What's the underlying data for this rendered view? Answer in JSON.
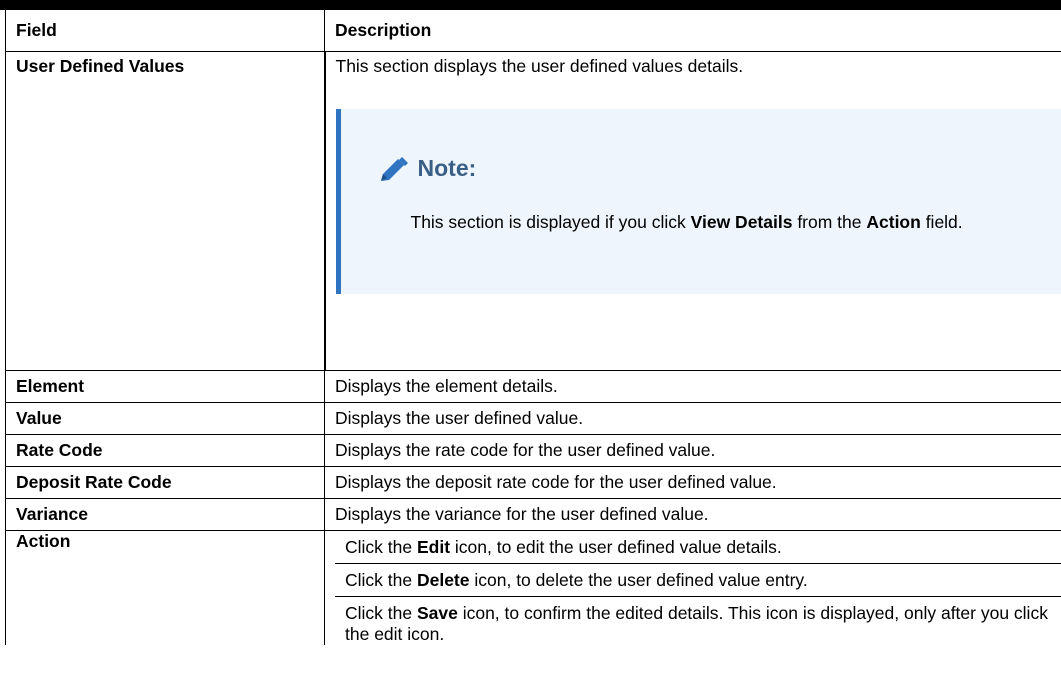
{
  "table": {
    "header": {
      "field": "Field",
      "description": "Description"
    },
    "udv": {
      "field": "User Defined Values",
      "description": "This section displays the user defined values details.",
      "note": {
        "icon": "pencil-icon",
        "title": "Note:",
        "text_1": "This section is displayed if you click ",
        "bold_1": "View Details",
        "text_2": " from the ",
        "bold_2": "Action",
        "text_3": " field."
      }
    },
    "rows": [
      {
        "field": "Element",
        "description": "Displays the element details."
      },
      {
        "field": "Value",
        "description": "Displays the user defined value."
      },
      {
        "field": "Rate Code",
        "description": "Displays the rate code for the user defined value."
      },
      {
        "field": "Deposit Rate Code",
        "description": "Displays the deposit rate code for the user defined value."
      },
      {
        "field": "Variance",
        "description": "Displays the variance for the user defined value."
      }
    ],
    "action": {
      "field": "Action",
      "lines": [
        {
          "pre": "Click the ",
          "bold": "Edit",
          "post": " icon, to edit the user defined value details."
        },
        {
          "pre": "Click the ",
          "bold": "Delete",
          "post": " icon, to delete the user defined value entry."
        },
        {
          "pre": "Click the ",
          "bold": "Save",
          "post": " icon, to confirm the edited details. This icon is displayed, only after you click the edit icon."
        }
      ]
    }
  },
  "colors": {
    "note_bg": "#eef5fd",
    "note_bar": "#2f74c1",
    "note_title": "#3a5f86",
    "pencil": "#2f74c1"
  }
}
